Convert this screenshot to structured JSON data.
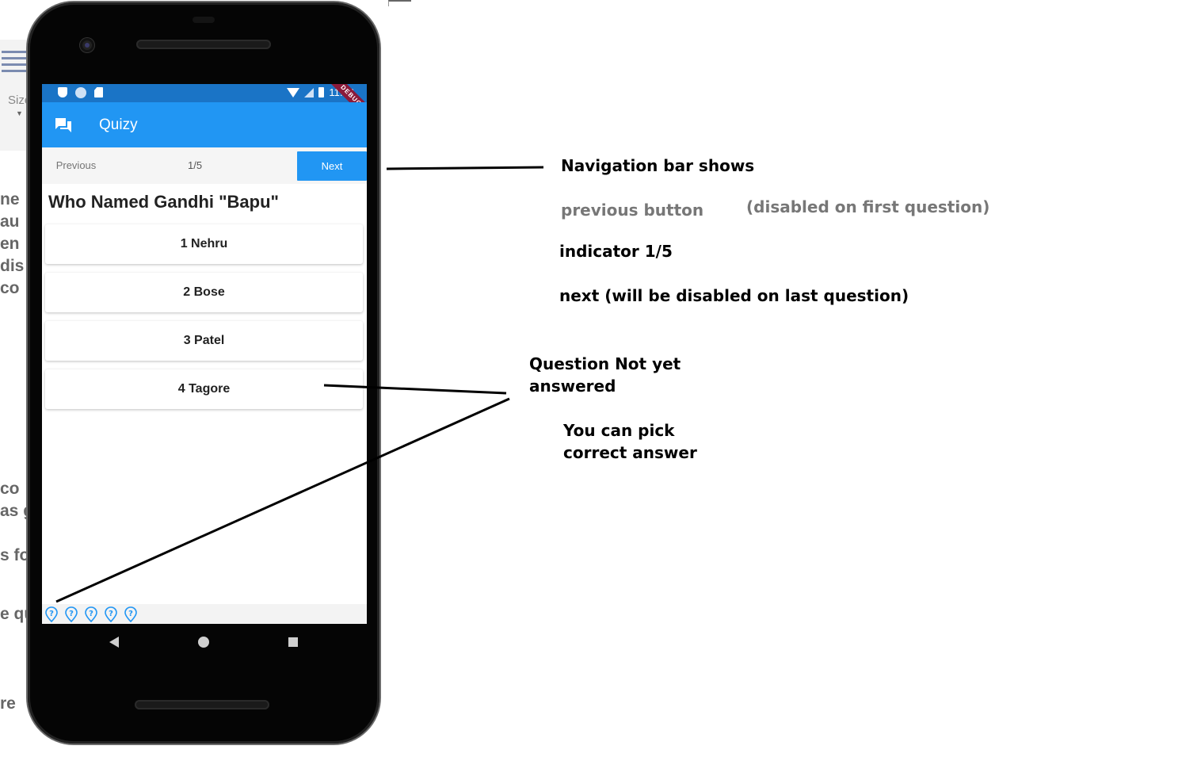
{
  "background_doc": {
    "size_label": "Size",
    "fragments": [
      "ne",
      "au",
      "en",
      "dis",
      "co",
      "co",
      "as g",
      "s fo",
      "e qu",
      "re"
    ]
  },
  "status_bar": {
    "time": "11:56",
    "debug_banner": "DEBUG"
  },
  "app_bar": {
    "title": "Quizy",
    "icon": "chat-bubbles-icon"
  },
  "nav_bar": {
    "previous_label": "Previous",
    "previous_enabled": false,
    "indicator": "1/5",
    "next_label": "Next",
    "next_enabled": true
  },
  "question": {
    "text": "Who Named Gandhi \"Bapu\"",
    "answers": [
      "1 Nehru",
      "2 Bose",
      "3 Patel",
      "4 Tagore"
    ]
  },
  "progress": {
    "total": 5,
    "icon": "question-marker-icon",
    "status": "unanswered"
  },
  "annotations": {
    "nav_title": "Navigation bar shows",
    "prev_note": "previous button",
    "prev_paren": "(disabled on first question)",
    "indicator_note": "indicator 1/5",
    "next_note": "next (will be disabled on last question)",
    "not_answered_line1": "Question Not yet",
    "not_answered_line2": "answered",
    "pick_line1": "You can pick",
    "pick_line2": "correct answer"
  },
  "colors": {
    "primary": "#2196f3",
    "status_bar": "#1a74c6",
    "debug": "#8b1a3a"
  }
}
